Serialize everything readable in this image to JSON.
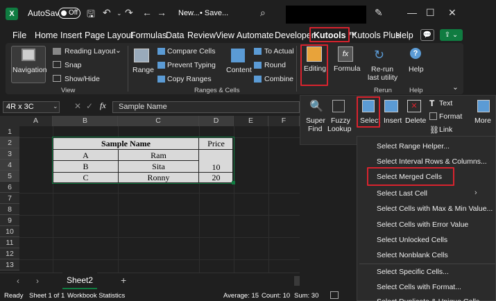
{
  "titlebar": {
    "app_letter": "X",
    "autosave_label": "AutoSave",
    "toggle_state": "Off",
    "doc_name": "New...",
    "save_state": "• Save..."
  },
  "menu": [
    "File",
    "Home",
    "Insert",
    "Page Layout",
    "Formulas",
    "Data",
    "Review",
    "View",
    "Automate",
    "Developer",
    "Kutools ™",
    "Kutools Plus",
    "Help"
  ],
  "ribbon": {
    "navigation": "Navigation",
    "reading_layout": "Reading Layout",
    "snap": "Snap",
    "show_hide": "Show/Hide",
    "view_group": "View",
    "range": "Range",
    "compare_cells": "Compare Cells",
    "prevent_typing": "Prevent Typing",
    "copy_ranges": "Copy Ranges",
    "content": "Content",
    "to_actual": "To Actual",
    "round": "Round",
    "combine": "Combine",
    "ranges_group": "Ranges & Cells",
    "editing": "Editing",
    "formula": "Formula",
    "rerun_1": "Re-run",
    "rerun_2": "last utility",
    "rerun_group": "Rerun",
    "help": "Help",
    "help_group": "Help"
  },
  "formula_bar": {
    "name_box": "4R x 3C",
    "fx": "fx",
    "content": "Sample Name"
  },
  "columns": [
    "A",
    "B",
    "C",
    "D",
    "E",
    "F"
  ],
  "rows": [
    "1",
    "2",
    "3",
    "4",
    "5",
    "6",
    "7",
    "8",
    "9",
    "10",
    "11",
    "12",
    "13"
  ],
  "table": {
    "header_merged": "Sample Name",
    "header_price": "Price",
    "rows": [
      [
        "A",
        "Ram",
        ""
      ],
      [
        "B",
        "Sita",
        "10"
      ],
      [
        "C",
        "Ronny",
        "20"
      ]
    ]
  },
  "editing_panel": {
    "super_find_1": "Super",
    "super_find_2": "Find",
    "fuzzy_1": "Fuzzy",
    "fuzzy_2": "Lookup",
    "select": "Select",
    "insert": "Insert",
    "delete": "Delete",
    "text": "Text",
    "format": "Format",
    "link": "Link",
    "more": "More"
  },
  "select_menu": [
    "Select Range Helper...",
    "Select Interval Rows & Columns...",
    "Select Merged Cells",
    "Select Last Cell",
    "Select Cells with Max & Min Value...",
    "Select Cells with Error Value",
    "Select Unlocked Cells",
    "Select Nonblank Cells",
    "Select Specific Cells...",
    "Select Cells with Format...",
    "Select Duplicate & Unique Cells..."
  ],
  "sheet_tab": "Sheet2",
  "status": {
    "ready": "Ready",
    "sheet": "Sheet 1 of 1",
    "stats": "Workbook Statistics",
    "average": "Average: 15",
    "count": "Count: 10",
    "sum": "Sum: 30"
  },
  "colors": {
    "accent_red": "#d9232e",
    "excel_green": "#107c41",
    "ribbon_bg": "#292929"
  }
}
